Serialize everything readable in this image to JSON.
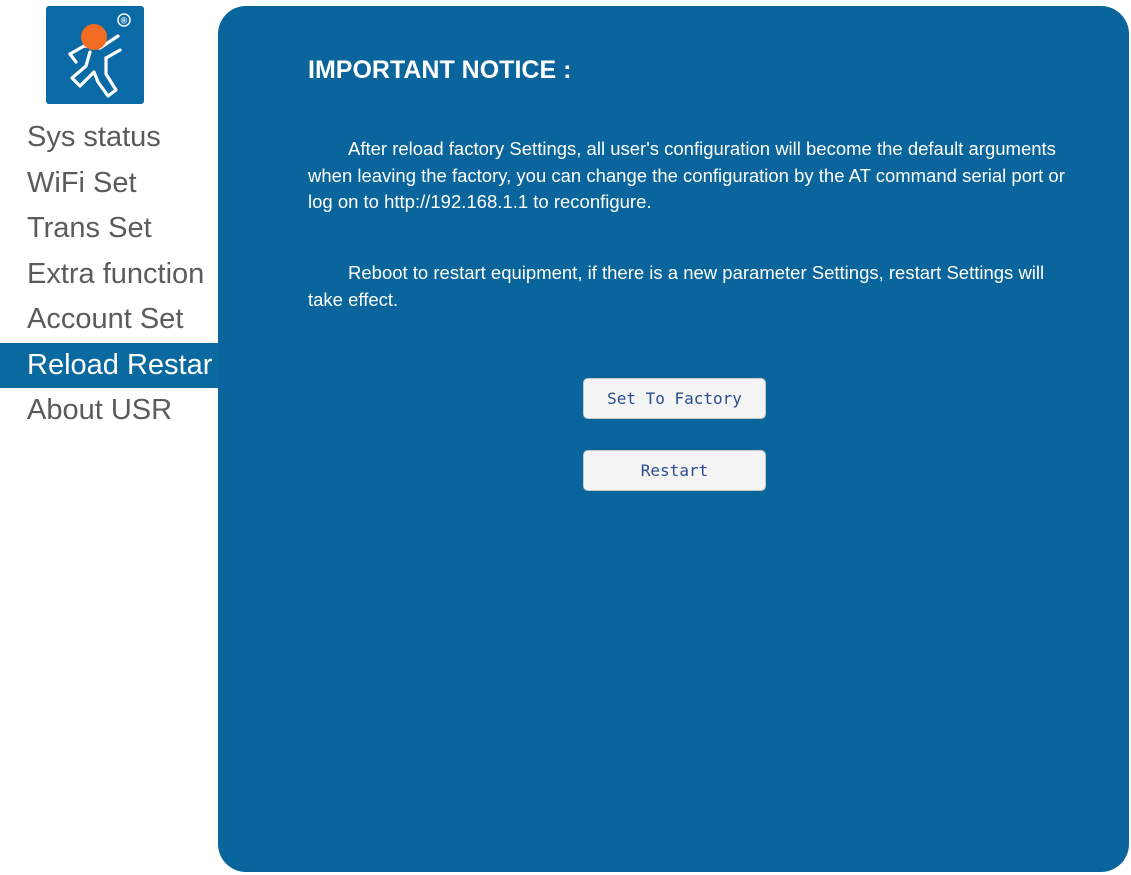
{
  "brand": {
    "logo_icon": "usr-runner-logo-icon",
    "registered_mark": "®",
    "colors": {
      "logo_blue": "#0a6aa6",
      "logo_orange": "#f26c24",
      "accent": "#09659b"
    }
  },
  "sidebar": {
    "items": [
      {
        "label": "Sys status",
        "active": false
      },
      {
        "label": "WiFi Set",
        "active": false
      },
      {
        "label": "Trans Set",
        "active": false
      },
      {
        "label": "Extra function",
        "active": false
      },
      {
        "label": "Account Set",
        "active": false
      },
      {
        "label": "Reload Restar",
        "active": true
      },
      {
        "label": "About USR",
        "active": false
      }
    ]
  },
  "main": {
    "title": "IMPORTANT NOTICE :",
    "paragraphs": [
      "After reload factory Settings, all user's configuration will become the default arguments when leaving the factory, you can change the configuration by the AT command serial port or log on to http://192.168.1.1 to reconfigure.",
      "Reboot to restart equipment, if there is a new parameter Settings, restart Settings will take effect."
    ],
    "buttons": {
      "factory_label": "Set To Factory",
      "restart_label": "Restart"
    }
  }
}
